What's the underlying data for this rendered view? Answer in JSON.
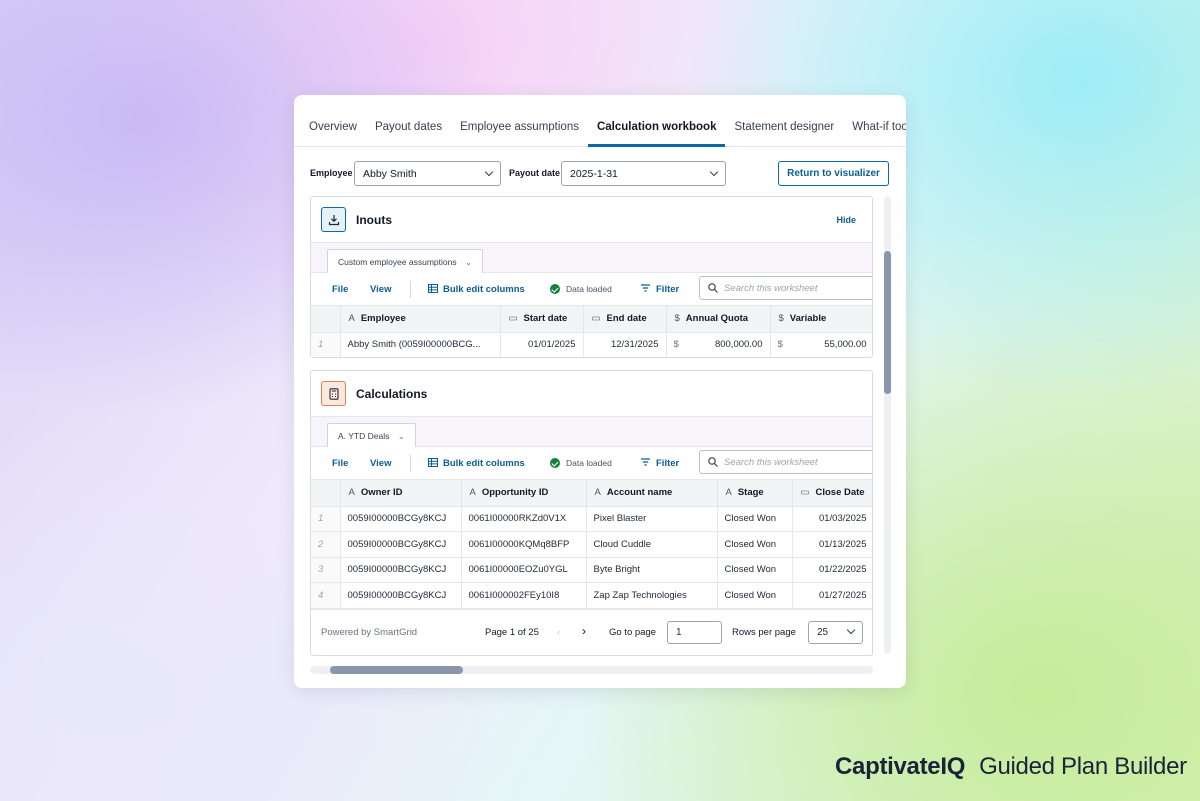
{
  "tabs": [
    "Overview",
    "Payout dates",
    "Employee assumptions",
    "Calculation workbook",
    "Statement designer",
    "What-if tool"
  ],
  "active_tab": "Calculation workbook",
  "filters": {
    "employee_label": "Employee",
    "employee_value": "Abby Smith",
    "payout_label": "Payout date",
    "payout_value": "2025-1-31",
    "return_button": "Return to visualizer"
  },
  "inputs_section": {
    "title": "Inouts",
    "hide_label": "Hide",
    "sheet_tab": "Custom employee assumptions",
    "toolbar": {
      "file": "File",
      "view": "View",
      "bulk_edit": "Bulk edit columns",
      "status": "Data loaded",
      "filter": "Filter",
      "search_placeholder": "Search this worksheet"
    },
    "columns": [
      {
        "icon": "text-icon",
        "label": "Employee"
      },
      {
        "icon": "calendar-icon",
        "label": "Start date"
      },
      {
        "icon": "calendar-icon",
        "label": "End date"
      },
      {
        "icon": "dollar-icon",
        "label": "Annual Quota"
      },
      {
        "icon": "dollar-icon",
        "label": "Variable"
      }
    ],
    "rows": [
      {
        "idx": "1",
        "employee": "Abby Smith (0059I00000BCG...",
        "start": "01/01/2025",
        "end": "12/31/2025",
        "quota_cur": "$",
        "quota": "800,000.00",
        "var_cur": "$",
        "variable": "55,000.00"
      }
    ]
  },
  "calc_section": {
    "title": "Calculations",
    "sheet_tab": "A. YTD Deals",
    "toolbar": {
      "file": "File",
      "view": "View",
      "bulk_edit": "Bulk edit columns",
      "status": "Data loaded",
      "filter": "Filter",
      "search_placeholder": "Search this worksheet"
    },
    "columns": [
      {
        "icon": "text-icon",
        "label": "Owner ID"
      },
      {
        "icon": "text-icon",
        "label": "Opportunity ID"
      },
      {
        "icon": "text-icon",
        "label": "Account name"
      },
      {
        "icon": "text-icon",
        "label": "Stage"
      },
      {
        "icon": "calendar-icon",
        "label": "Close Date"
      }
    ],
    "rows": [
      {
        "idx": "1",
        "owner": "0059I00000BCGy8KCJ",
        "opp": "0061I00000RKZd0V1X",
        "account": "Pixel Blaster",
        "stage": "Closed Won",
        "close": "01/03/2025"
      },
      {
        "idx": "2",
        "owner": "0059I00000BCGy8KCJ",
        "opp": "0061I00000KQMq8BFP",
        "account": "Cloud Cuddle",
        "stage": "Closed Won",
        "close": "01/13/2025"
      },
      {
        "idx": "3",
        "owner": "0059I00000BCGy8KCJ",
        "opp": "0061I00000EOZu0YGL",
        "account": "Byte Bright",
        "stage": "Closed Won",
        "close": "01/22/2025"
      },
      {
        "idx": "4",
        "owner": "0059I00000BCGy8KCJ",
        "opp": "0061I000002FEy10I8",
        "account": "Zap Zap Technologies",
        "stage": "Closed Won",
        "close": "01/27/2025"
      }
    ],
    "pager": {
      "powered_by": "Powered by SmartGrid",
      "page_text": "Page 1 of 25",
      "goto_label": "Go to page",
      "goto_value": "1",
      "rows_label": "Rows per page",
      "rows_value": "25"
    }
  },
  "brand": {
    "company": "CaptivateIQ",
    "product": "Guided Plan Builder"
  },
  "colors": {
    "accent": "#0b6aa6",
    "status_green": "#15803d",
    "scrollbar": "#8a96ab"
  }
}
